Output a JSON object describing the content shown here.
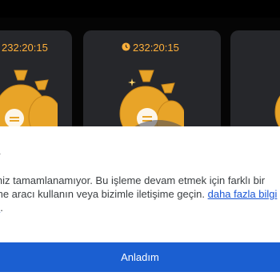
{
  "colors": {
    "timer_accent": "#ffb03a",
    "card_background": "#26272b",
    "button_background": "#1b5fd1",
    "link": "#1a56d6"
  },
  "cards": [
    {
      "timer": "232:20:15",
      "icon": "money-bag-icon"
    },
    {
      "timer": "232:20:15",
      "icon": "money-bag-icon",
      "timer_icon": "clock-icon"
    },
    {
      "icon": "money-bag-icon"
    }
  ],
  "dialog": {
    "title": "a",
    "message_line1": "iniz tamamlanamıyor. Bu işleme devam etmek için farklı bir",
    "message_line2_prefix": "me aracı kullanın veya bizimle iletişime geçin. ",
    "link_part1": "daha fazla bilgi",
    "link_part2": "n",
    "message_end": ".",
    "ok_button": "Anladım"
  }
}
